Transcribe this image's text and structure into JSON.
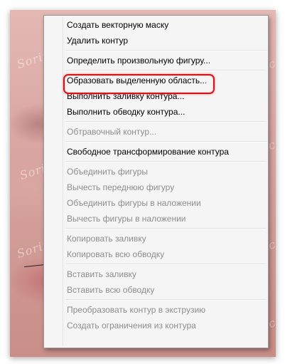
{
  "watermark": {
    "text": "Soringpcrepair.com"
  },
  "menu": {
    "items": [
      {
        "label": "Создать векторную маску",
        "enabled": true
      },
      {
        "label": "Удалить контур",
        "enabled": true
      },
      {
        "label": "Определить произвольную фигуру...",
        "enabled": true
      },
      {
        "label": "Образовать выделенную область...",
        "enabled": true,
        "emphasized": true
      },
      {
        "label": "Выполнить заливку контура...",
        "enabled": true
      },
      {
        "label": "Выполнить обводку контура...",
        "enabled": true
      },
      {
        "label": "Обтравочный контур...",
        "enabled": false
      },
      {
        "label": "Свободное трансформирование контура",
        "enabled": true
      },
      {
        "label": "Объединить фигуры",
        "enabled": false
      },
      {
        "label": "Вычесть переднюю фигуру",
        "enabled": false
      },
      {
        "label": "Объединить фигуры в наложении",
        "enabled": false
      },
      {
        "label": "Вычесть фигуры в наложении",
        "enabled": false
      },
      {
        "label": "Копировать заливку",
        "enabled": false
      },
      {
        "label": "Копировать всю обводку",
        "enabled": false
      },
      {
        "label": "Вставить заливку",
        "enabled": false
      },
      {
        "label": "Вставить всю обводку",
        "enabled": false
      },
      {
        "label": "Преобразовать контур в экструзию",
        "enabled": false
      },
      {
        "label": "Создать ограничения из контура",
        "enabled": false
      }
    ],
    "highlight_color": "#d4131b"
  }
}
